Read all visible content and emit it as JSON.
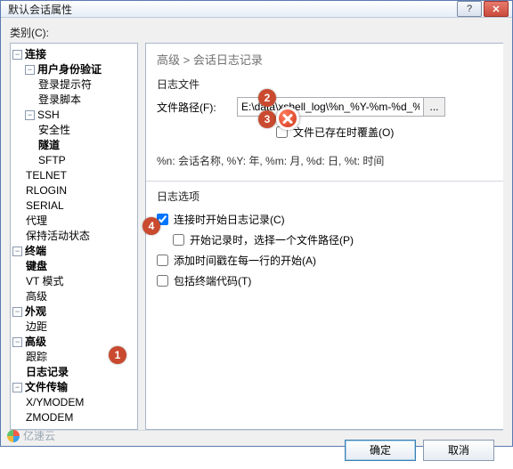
{
  "window": {
    "title": "默认会话属性",
    "help": "?",
    "close": "✕"
  },
  "category_label": "类别(C):",
  "tree": {
    "connection": "连接",
    "auth": "用户身份验证",
    "login_prompt": "登录提示符",
    "login_script": "登录脚本",
    "ssh": "SSH",
    "security": "安全性",
    "tunnel": "隧道",
    "sftp": "SFTP",
    "telnet": "TELNET",
    "rlogin": "RLOGIN",
    "serial": "SERIAL",
    "proxy": "代理",
    "keepalive": "保持活动状态",
    "terminal": "终端",
    "keyboard": "键盘",
    "vtmode": "VT 模式",
    "advanced_t": "高级",
    "appearance": "外观",
    "margins": "边距",
    "advanced": "高级",
    "trace": "跟踪",
    "logging": "日志记录",
    "filetransfer": "文件传输",
    "xymodem": "X/YMODEM",
    "zmodem": "ZMODEM"
  },
  "crumb": "高级 > 会话日志记录",
  "log": {
    "section": "日志文件",
    "path_label": "文件路径(F):",
    "path_value": "E:\\data\\xshell_log\\%n_%Y-%m-%d_%t.lo",
    "browse": "...",
    "overwrite": "文件已存在时覆盖(O)",
    "hint": "%n: 会话名称, %Y: 年, %m: 月, %d: 日, %t: 时间"
  },
  "options": {
    "section": "日志选项",
    "opt1": "连接时开始日志记录(C)",
    "opt2": "开始记录时，选择一个文件路径(P)",
    "opt3": "添加时间戳在每一行的开始(A)",
    "opt4": "包括终端代码(T)"
  },
  "buttons": {
    "ok": "确定",
    "cancel": "取消"
  },
  "badges": {
    "b1": "1",
    "b2": "2",
    "b3": "3",
    "b4": "4"
  },
  "watermark": "亿速云"
}
